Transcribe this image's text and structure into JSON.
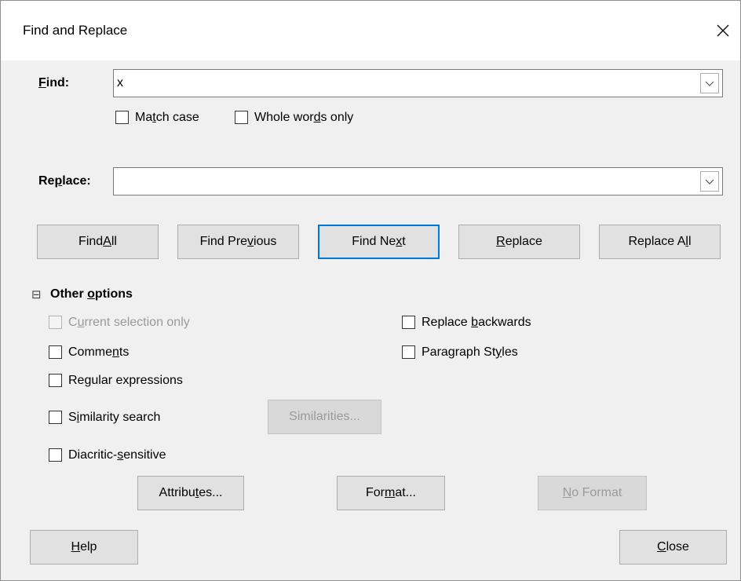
{
  "dialog": {
    "title": "Find and Replace",
    "close_glyph": "✕"
  },
  "find": {
    "label_u": "F",
    "label_rest": "ind:",
    "value": "x"
  },
  "options_top": {
    "match_case": {
      "a": "Ma",
      "u": "t",
      "b": "ch case",
      "checked": false
    },
    "whole_words": {
      "a": "Whole wor",
      "u": "d",
      "b": "s only",
      "checked": false
    }
  },
  "replace": {
    "label_a": "Re",
    "label_u": "p",
    "label_b": "lace:",
    "value": ""
  },
  "buttons": {
    "find_all": {
      "a": "Find ",
      "u": "A",
      "b": "ll"
    },
    "find_previous": {
      "a": "Find Pre",
      "u": "v",
      "b": "ious"
    },
    "find_next": {
      "a": "Find Ne",
      "u": "x",
      "b": "t"
    },
    "replace": {
      "a": "",
      "u": "R",
      "b": "eplace"
    },
    "replace_all": {
      "a": "Replace A",
      "u": "l",
      "b": "l"
    }
  },
  "other_options": {
    "expander_glyph": "⊟",
    "label_a": "Other ",
    "label_u": "o",
    "label_b": "ptions",
    "current_selection": {
      "a": "C",
      "u": "u",
      "b": "rrent selection only",
      "enabled": false
    },
    "comments": {
      "a": "Comme",
      "u": "n",
      "b": "ts"
    },
    "regular_expressions": {
      "a": "Re",
      "u": "g",
      "b": "ular expressions"
    },
    "similarity_search": {
      "a": "S",
      "u": "i",
      "b": "milarity search"
    },
    "similarities_button": "Similarities...",
    "diacritic": {
      "a": "Diacritic-",
      "u": "s",
      "b": "ensitive"
    },
    "replace_backwards": {
      "a": "Replace ",
      "u": "b",
      "b": "ackwards"
    },
    "paragraph_styles": {
      "a": "Paragraph St",
      "u": "y",
      "b": "les"
    }
  },
  "format_buttons": {
    "attributes": {
      "a": "Attribu",
      "u": "t",
      "b": "es..."
    },
    "format": {
      "a": "For",
      "u": "m",
      "b": "at..."
    },
    "no_format": {
      "a": "",
      "u": "N",
      "b": "o Format"
    }
  },
  "footer": {
    "help": {
      "a": "",
      "u": "H",
      "b": "elp"
    },
    "close": {
      "a": "",
      "u": "C",
      "b": "lose"
    }
  },
  "colors": {
    "accent": "#0078d7",
    "background": "#f0f0f0",
    "disabled_text": "#9a9a9a"
  }
}
